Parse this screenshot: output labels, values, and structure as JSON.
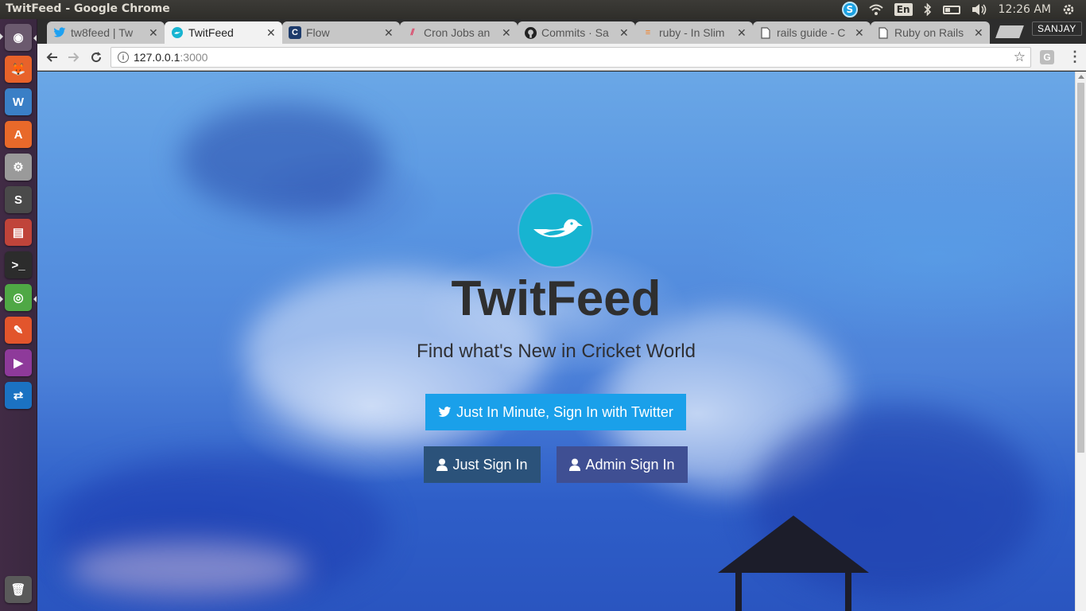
{
  "system": {
    "window_title": "TwitFeed - Google Chrome",
    "keyboard_lang": "En",
    "clock": "12:26 AM",
    "skype_glyph": "S"
  },
  "launcher": {
    "items": [
      {
        "name": "dash-icon",
        "glyph": "◉",
        "bg": "#6b5a6e"
      },
      {
        "name": "firefox-icon",
        "glyph": "🦊",
        "bg": "#e8622a"
      },
      {
        "name": "libreoffice-writer-icon",
        "glyph": "W",
        "bg": "#3a7fc6"
      },
      {
        "name": "software-center-icon",
        "glyph": "A",
        "bg": "#e8692a"
      },
      {
        "name": "system-settings-icon",
        "glyph": "⚙",
        "bg": "#9a9a9a"
      },
      {
        "name": "sublime-text-icon",
        "glyph": "S",
        "bg": "#4a4a4a"
      },
      {
        "name": "files-icon",
        "glyph": "▤",
        "bg": "#c0443a"
      },
      {
        "name": "terminal-icon",
        "glyph": ">_",
        "bg": "#2c2c2c"
      },
      {
        "name": "chrome-icon",
        "glyph": "◎",
        "bg": "#4fa845"
      },
      {
        "name": "pencil-app-icon",
        "glyph": "✎",
        "bg": "#e2552c"
      },
      {
        "name": "video-app-icon",
        "glyph": "▶",
        "bg": "#8e3a9a"
      },
      {
        "name": "teamviewer-icon",
        "glyph": "⇄",
        "bg": "#1b72c2"
      },
      {
        "name": "trash-icon",
        "glyph": "🗑",
        "bg": "#5a5a5a"
      }
    ]
  },
  "browser": {
    "tabs": [
      {
        "label": "tw8feed | Tw",
        "icon": "twitter-icon",
        "active": false
      },
      {
        "label": "TwitFeed",
        "icon": "twitfeed-icon",
        "active": true
      },
      {
        "label": "Flow",
        "icon": "flow-icon",
        "active": false
      },
      {
        "label": "Cron Jobs an",
        "icon": "cron-icon",
        "active": false
      },
      {
        "label": "Commits · Sa",
        "icon": "github-icon",
        "active": false
      },
      {
        "label": "ruby - In Slim",
        "icon": "stackoverflow-icon",
        "active": false
      },
      {
        "label": "rails guide - C",
        "icon": "document-icon",
        "active": false
      },
      {
        "label": "Ruby on Rails",
        "icon": "document-icon",
        "active": false
      }
    ],
    "profile_name": "SANJAY",
    "url_host": "127.0.0.1",
    "url_port": ":3000",
    "extension_glyph": "G"
  },
  "page": {
    "brand_title": "TwitFeed",
    "tagline": "Find what's New in Cricket World",
    "twitter_button_label": "Just In Minute, Sign In with Twitter",
    "just_sign_in_label": "Just Sign In",
    "admin_sign_in_label": "Admin Sign In",
    "colors": {
      "logo": "#17b4d1",
      "twitter_button": "#1aa0ea",
      "just_sign_in_button": "#2b527a",
      "admin_sign_in_button": "#3f4f93"
    }
  }
}
